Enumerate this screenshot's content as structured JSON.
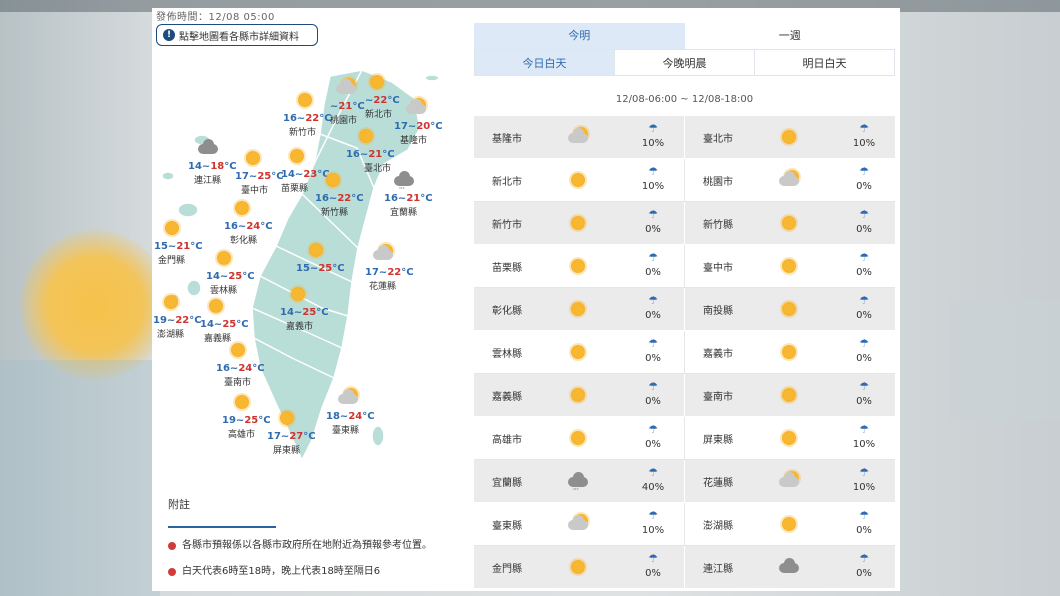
{
  "publish_time": "發佈時間：12/08 05:00",
  "map_hint": "點擊地圖看各縣市詳細資料",
  "map_cities": [
    {
      "name": "新竹市",
      "lo": "16",
      "hi": "22"
    },
    {
      "name": "桃園市",
      "lo": "",
      "hi": "21"
    },
    {
      "name": "新北市",
      "lo": "",
      "hi": "22"
    },
    {
      "name": "基隆市",
      "lo": "17",
      "hi": "20"
    },
    {
      "name": "臺北市",
      "lo": "16",
      "hi": "21"
    },
    {
      "name": "連江縣",
      "lo": "14",
      "hi": "18"
    },
    {
      "name": "臺中市",
      "lo": "17",
      "hi": "25"
    },
    {
      "name": "苗栗縣",
      "lo": "14",
      "hi": "23"
    },
    {
      "name": "新竹縣",
      "lo": "16",
      "hi": "22"
    },
    {
      "name": "宜蘭縣",
      "lo": "16",
      "hi": "21"
    },
    {
      "name": "彰化縣",
      "lo": "16",
      "hi": "24"
    },
    {
      "name": "金門縣",
      "lo": "15",
      "hi": "21"
    },
    {
      "name": "南投縣",
      "lo": "15",
      "hi": "25"
    },
    {
      "name": "花蓮縣",
      "lo": "17",
      "hi": "22"
    },
    {
      "name": "雲林縣",
      "lo": "14",
      "hi": "25"
    },
    {
      "name": "嘉義市",
      "lo": "14",
      "hi": "25"
    },
    {
      "name": "澎湖縣",
      "lo": "19",
      "hi": "22"
    },
    {
      "name": "嘉義縣",
      "lo": "14",
      "hi": "25"
    },
    {
      "name": "臺南市",
      "lo": "16",
      "hi": "24"
    },
    {
      "name": "高雄市",
      "lo": "19",
      "hi": "25"
    },
    {
      "name": "屏東縣",
      "lo": "17",
      "hi": "27"
    },
    {
      "name": "臺東縣",
      "lo": "18",
      "hi": "24"
    }
  ],
  "notes": {
    "title": "附註",
    "items": [
      "各縣市預報係以各縣市政府所在地附近為預報參考位置。",
      "白天代表6時至18時，晚上代表18時至隔日6"
    ]
  },
  "tabs": [
    "今明",
    "一週"
  ],
  "subtabs": [
    "今日白天",
    "今晚明晨",
    "明日白天"
  ],
  "time_range": "12/08-06:00 ~ 12/08-18:00",
  "rows": [
    [
      {
        "city": "基隆市",
        "icon": "cloudy-sun-icon",
        "rain": "10%"
      },
      {
        "city": "臺北市",
        "icon": "sunny-icon",
        "rain": "10%"
      }
    ],
    [
      {
        "city": "新北市",
        "icon": "sunny-icon",
        "rain": "10%"
      },
      {
        "city": "桃園市",
        "icon": "cloudy-sun-icon",
        "rain": "0%"
      }
    ],
    [
      {
        "city": "新竹市",
        "icon": "sunny-icon",
        "rain": "0%"
      },
      {
        "city": "新竹縣",
        "icon": "sunny-icon",
        "rain": "0%"
      }
    ],
    [
      {
        "city": "苗栗縣",
        "icon": "sunny-icon",
        "rain": "0%"
      },
      {
        "city": "臺中市",
        "icon": "sunny-icon",
        "rain": "0%"
      }
    ],
    [
      {
        "city": "彰化縣",
        "icon": "sunny-icon",
        "rain": "0%"
      },
      {
        "city": "南投縣",
        "icon": "sunny-icon",
        "rain": "0%"
      }
    ],
    [
      {
        "city": "雲林縣",
        "icon": "sunny-icon",
        "rain": "0%"
      },
      {
        "city": "嘉義市",
        "icon": "sunny-icon",
        "rain": "0%"
      }
    ],
    [
      {
        "city": "嘉義縣",
        "icon": "sunny-icon",
        "rain": "0%"
      },
      {
        "city": "臺南市",
        "icon": "sunny-icon",
        "rain": "0%"
      }
    ],
    [
      {
        "city": "高雄市",
        "icon": "sunny-icon",
        "rain": "0%"
      },
      {
        "city": "屏東縣",
        "icon": "sunny-icon",
        "rain": "10%"
      }
    ],
    [
      {
        "city": "宜蘭縣",
        "icon": "rain-cloud-icon",
        "rain": "40%"
      },
      {
        "city": "花蓮縣",
        "icon": "cloudy-sun-icon",
        "rain": "10%"
      }
    ],
    [
      {
        "city": "臺東縣",
        "icon": "cloudy-sun-icon",
        "rain": "10%"
      },
      {
        "city": "澎湖縣",
        "icon": "sunny-icon",
        "rain": "0%"
      }
    ],
    [
      {
        "city": "金門縣",
        "icon": "sunny-icon",
        "rain": "0%"
      },
      {
        "city": "連江縣",
        "icon": "cloud-icon",
        "rain": "0%"
      }
    ]
  ],
  "colors": {
    "accent": "#2f6bb0",
    "map_land": "#b9ded8",
    "high_temp": "#d0332f",
    "low_temp": "#2f6bb0"
  }
}
